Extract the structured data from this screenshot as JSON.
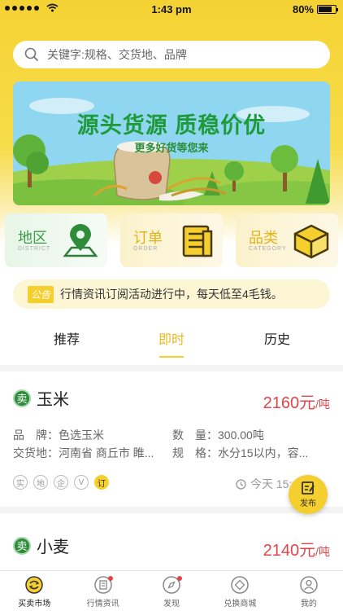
{
  "status_bar": {
    "time": "1:43 pm",
    "battery": "80%",
    "battery_level": 0.8
  },
  "search": {
    "placeholder": "关键字:规格、交货地、品牌",
    "icon": "search-icon"
  },
  "banner": {
    "title": "源头货源 质稳价优",
    "subtitle": "更多好货等您来"
  },
  "categories": [
    {
      "name": "地区",
      "en": "DISTRICT",
      "icon": "map-pin-icon"
    },
    {
      "name": "订单",
      "en": "ORDER",
      "icon": "order-list-icon"
    },
    {
      "name": "品类",
      "en": "CATEGORY",
      "icon": "box-icon"
    }
  ],
  "notice": {
    "tag": "公告",
    "text": "行情资讯订阅活动进行中，每天低至4毛钱。"
  },
  "tabs": [
    {
      "label": "推荐"
    },
    {
      "label": "即时"
    },
    {
      "label": "历史"
    }
  ],
  "active_tab": "即时",
  "listings": [
    {
      "badge": "卖",
      "name": "玉米",
      "price": "2160元",
      "unit": "/吨",
      "brand_label": "品　牌：",
      "brand": "色选玉米",
      "qty_label": "数　量：",
      "qty": "300.00吨",
      "place_label": "交货地：",
      "place": "河南省 商丘市 睢...",
      "spec_label": "规　格：",
      "spec": "水分15以内，容...",
      "tags": [
        "实",
        "地",
        "企",
        "V",
        "订"
      ],
      "time": "今天 15:45"
    },
    {
      "badge": "卖",
      "name": "小麦",
      "price": "2140元",
      "unit": "/吨"
    }
  ],
  "fab": {
    "label": "发布",
    "icon": "edit-icon"
  },
  "tabbar": [
    {
      "label": "买卖市场",
      "icon": "market-icon",
      "active": true
    },
    {
      "label": "行情资讯",
      "icon": "news-icon",
      "dot": true
    },
    {
      "label": "发现",
      "icon": "compass-icon",
      "dot": true
    },
    {
      "label": "兑换商城",
      "icon": "exchange-icon"
    },
    {
      "label": "我的",
      "icon": "user-icon"
    }
  ],
  "colors": {
    "brand_yellow": "#f5cf2e",
    "price_red": "#e0454a",
    "sell_green": "#2e8b3a"
  }
}
